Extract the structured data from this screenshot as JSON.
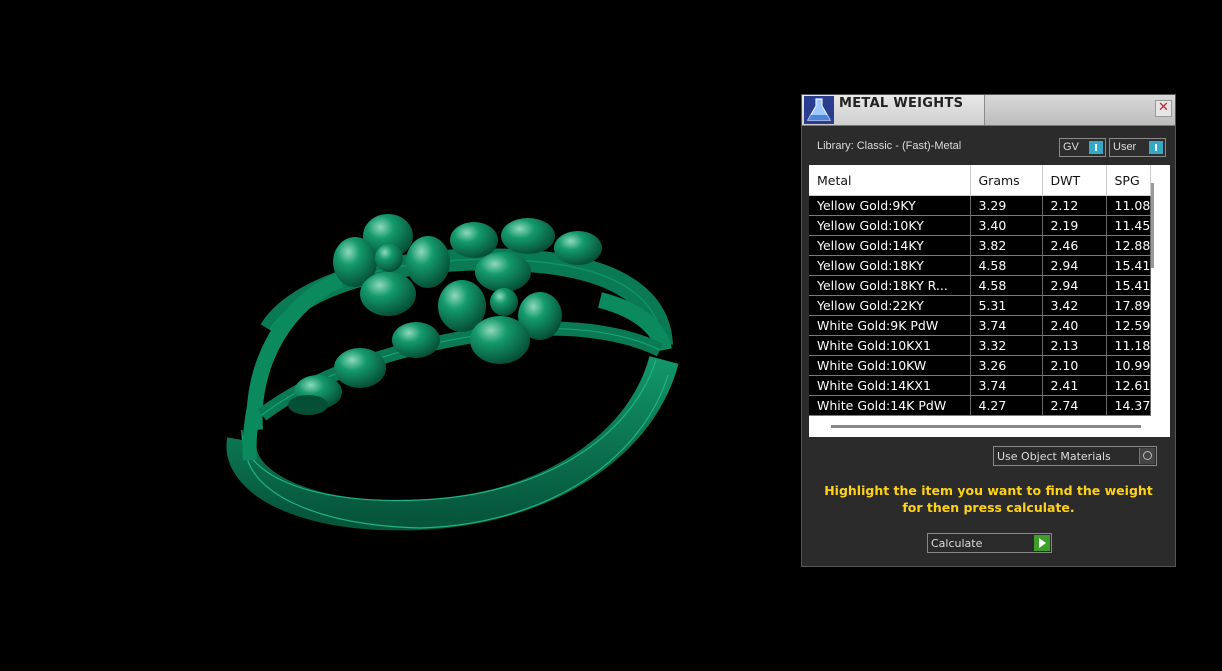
{
  "panel": {
    "title": "METAL WEIGHTS",
    "close_glyph": "✕",
    "library_label": "Library: Classic - (Fast)-Metal",
    "toggles": [
      {
        "label": "GV",
        "state": "on"
      },
      {
        "label": "User",
        "state": "on"
      }
    ],
    "table": {
      "columns": [
        "Metal",
        "Grams",
        "DWT",
        "SPG"
      ],
      "rows": [
        [
          "Yellow Gold:9KY",
          "3.29",
          "2.12",
          "11.08"
        ],
        [
          "Yellow Gold:10KY",
          "3.40",
          "2.19",
          "11.45"
        ],
        [
          "Yellow Gold:14KY",
          "3.82",
          "2.46",
          "12.88"
        ],
        [
          "Yellow Gold:18KY",
          "4.58",
          "2.94",
          "15.41"
        ],
        [
          "Yellow Gold:18KY R...",
          "4.58",
          "2.94",
          "15.41"
        ],
        [
          "Yellow Gold:22KY",
          "5.31",
          "3.42",
          "17.89"
        ],
        [
          "White Gold:9K PdW",
          "3.74",
          "2.40",
          "12.59"
        ],
        [
          "White Gold:10KX1",
          "3.32",
          "2.13",
          "11.18"
        ],
        [
          "White Gold:10KW",
          "3.26",
          "2.10",
          "10.99"
        ],
        [
          "White Gold:14KX1",
          "3.74",
          "2.41",
          "12.61"
        ],
        [
          "White Gold:14K PdW",
          "4.27",
          "2.74",
          "14.37"
        ]
      ]
    },
    "materials_select": "Use Object Materials",
    "instruction_line1": "Highlight the item you want to find the weight",
    "instruction_line2": "for then press calculate.",
    "calculate_label": "Calculate",
    "colors": {
      "accent_toggle": "#35a9c4",
      "instruction": "#ffd21a",
      "calculate_icon": "#3e9e2a"
    }
  },
  "viewport": {
    "object": "ring-3d-model",
    "color": "#0a7a55"
  }
}
